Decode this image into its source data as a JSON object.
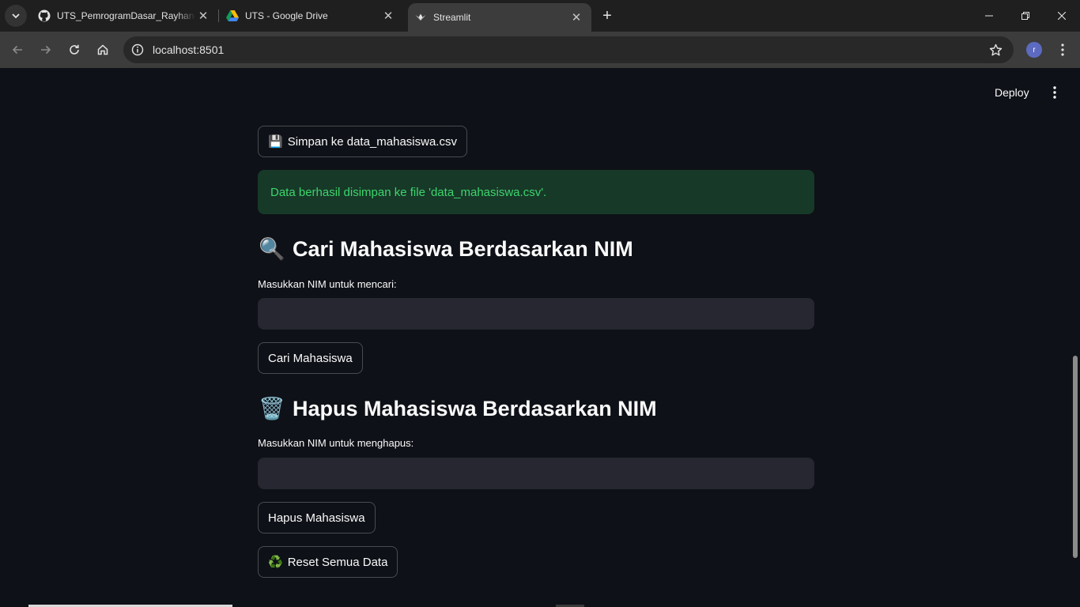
{
  "browser": {
    "tabs": [
      {
        "title": "UTS_PemrogramDasar_Rayhan-",
        "favicon": "github-icon"
      },
      {
        "title": "UTS - Google Drive",
        "favicon": "google-drive-icon"
      },
      {
        "title": "Streamlit",
        "favicon": "streamlit-icon",
        "active": true
      }
    ],
    "url": "localhost:8501",
    "profile_initial": "r"
  },
  "header": {
    "deploy_label": "Deploy"
  },
  "main": {
    "save_button": {
      "emoji": "💾",
      "label": "Simpan ke data_mahasiswa.csv"
    },
    "success_message": "Data berhasil disimpan ke file 'data_mahasiswa.csv'.",
    "search_section": {
      "emoji": "🔍",
      "title": "Cari Mahasiswa Berdasarkan NIM",
      "input_label": "Masukkan NIM untuk mencari:",
      "input_value": "",
      "button_label": "Cari Mahasiswa"
    },
    "delete_section": {
      "emoji": "🗑️",
      "title": "Hapus Mahasiswa Berdasarkan NIM",
      "input_label": "Masukkan NIM untuk menghapus:",
      "input_value": "",
      "button_label": "Hapus Mahasiswa"
    },
    "reset_button": {
      "emoji": "♻️",
      "label": "Reset Semua Data"
    }
  },
  "colors": {
    "background": "#0e1117",
    "success_bg": "#173928",
    "success_text": "#3dd56d",
    "input_bg": "#262730"
  }
}
